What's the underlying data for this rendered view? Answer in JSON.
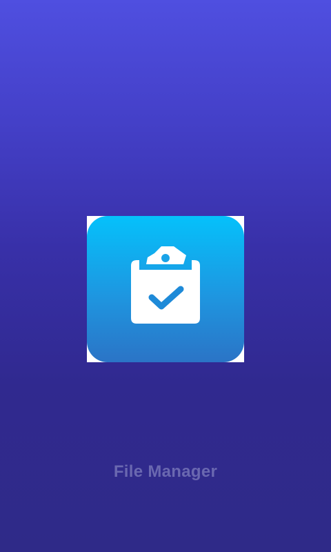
{
  "splash": {
    "app_name": "File Manager",
    "logo_icon": "clipboard-check-icon"
  },
  "colors": {
    "background_top": "#4f4fe0",
    "background_bottom": "#2f2a88",
    "icon_tile_top": "#05c1fb",
    "icon_tile_bottom": "#2b74c6",
    "app_name_text": "#6a68b0"
  }
}
